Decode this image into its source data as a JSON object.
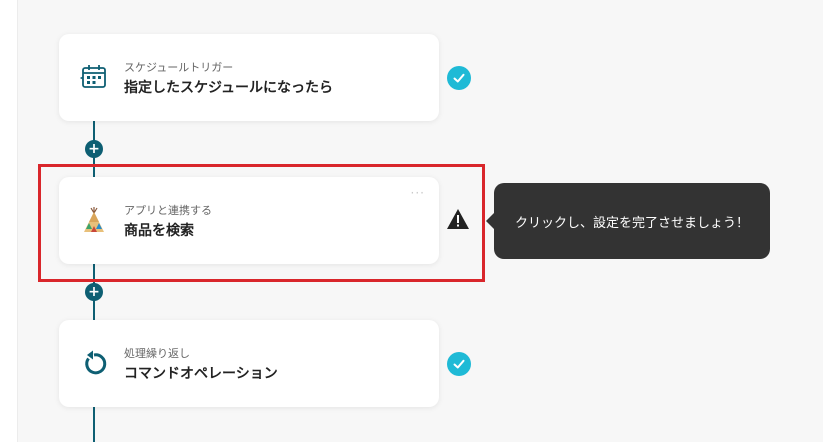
{
  "flow": {
    "steps": [
      {
        "subtitle": "スケジュールトリガー",
        "title": "指定したスケジュールになったら",
        "icon": "calendar-clock-icon",
        "status": "complete"
      },
      {
        "subtitle": "アプリと連携する",
        "title": "商品を検索",
        "icon": "teepee-app-icon",
        "status": "warning",
        "more": "···"
      },
      {
        "subtitle": "処理繰り返し",
        "title": "コマンドオペレーション",
        "icon": "loop-icon",
        "status": "complete"
      }
    ],
    "add_symbol": "+"
  },
  "tooltip": {
    "text": "クリックし、設定を完了させましょう！"
  },
  "colors": {
    "accent": "#0e5f73",
    "check": "#1fbad6",
    "highlight": "#d9262b",
    "tooltip_bg": "#333333"
  }
}
